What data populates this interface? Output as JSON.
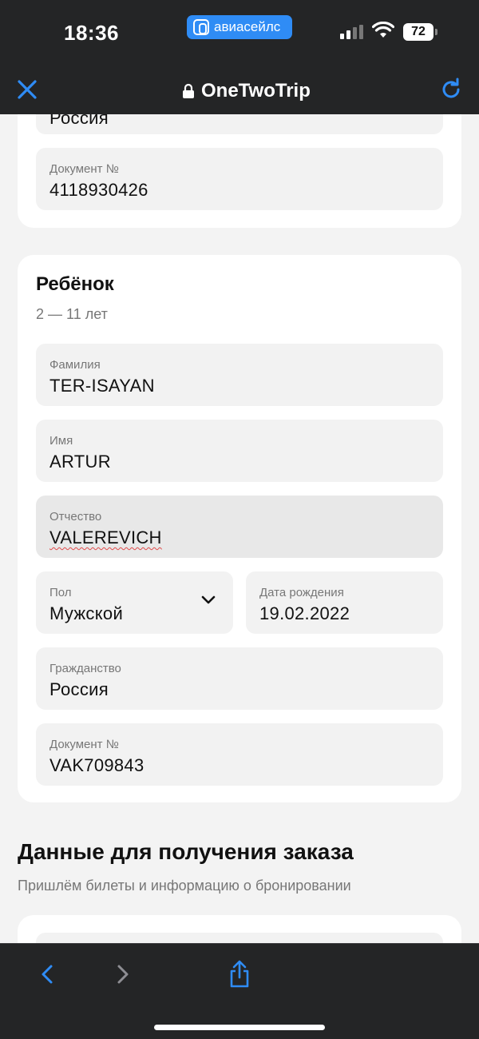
{
  "status_bar": {
    "time": "18:36",
    "app_back_label": "авиасейлс",
    "battery": "72"
  },
  "browser": {
    "site_name": "OneTwoTrip",
    "accent_color": "#2f8cf5"
  },
  "adult_card": {
    "partial_value": "Россия",
    "document_label": "Документ №",
    "document_value": "4118930426"
  },
  "child_card": {
    "title": "Ребёнок",
    "age_range": "2 — 11 лет",
    "surname_label": "Фамилия",
    "surname_value": "TER-ISAYAN",
    "name_label": "Имя",
    "name_value": "ARTUR",
    "patronymic_label": "Отчество",
    "patronymic_value": "VALEREVICH",
    "gender_label": "Пол",
    "gender_value": "Мужской",
    "birthdate_label": "Дата рождения",
    "birthdate_value": "19.02.2022",
    "citizenship_label": "Гражданство",
    "citizenship_value": "Россия",
    "document_label": "Документ №",
    "document_value": "VAK709843"
  },
  "order_section": {
    "title": "Данные для получения заказа",
    "subtitle": "Пришлём билеты и информацию о бронировании"
  },
  "toolbar": {
    "icons": [
      "back-icon",
      "forward-icon",
      "share-icon"
    ]
  }
}
